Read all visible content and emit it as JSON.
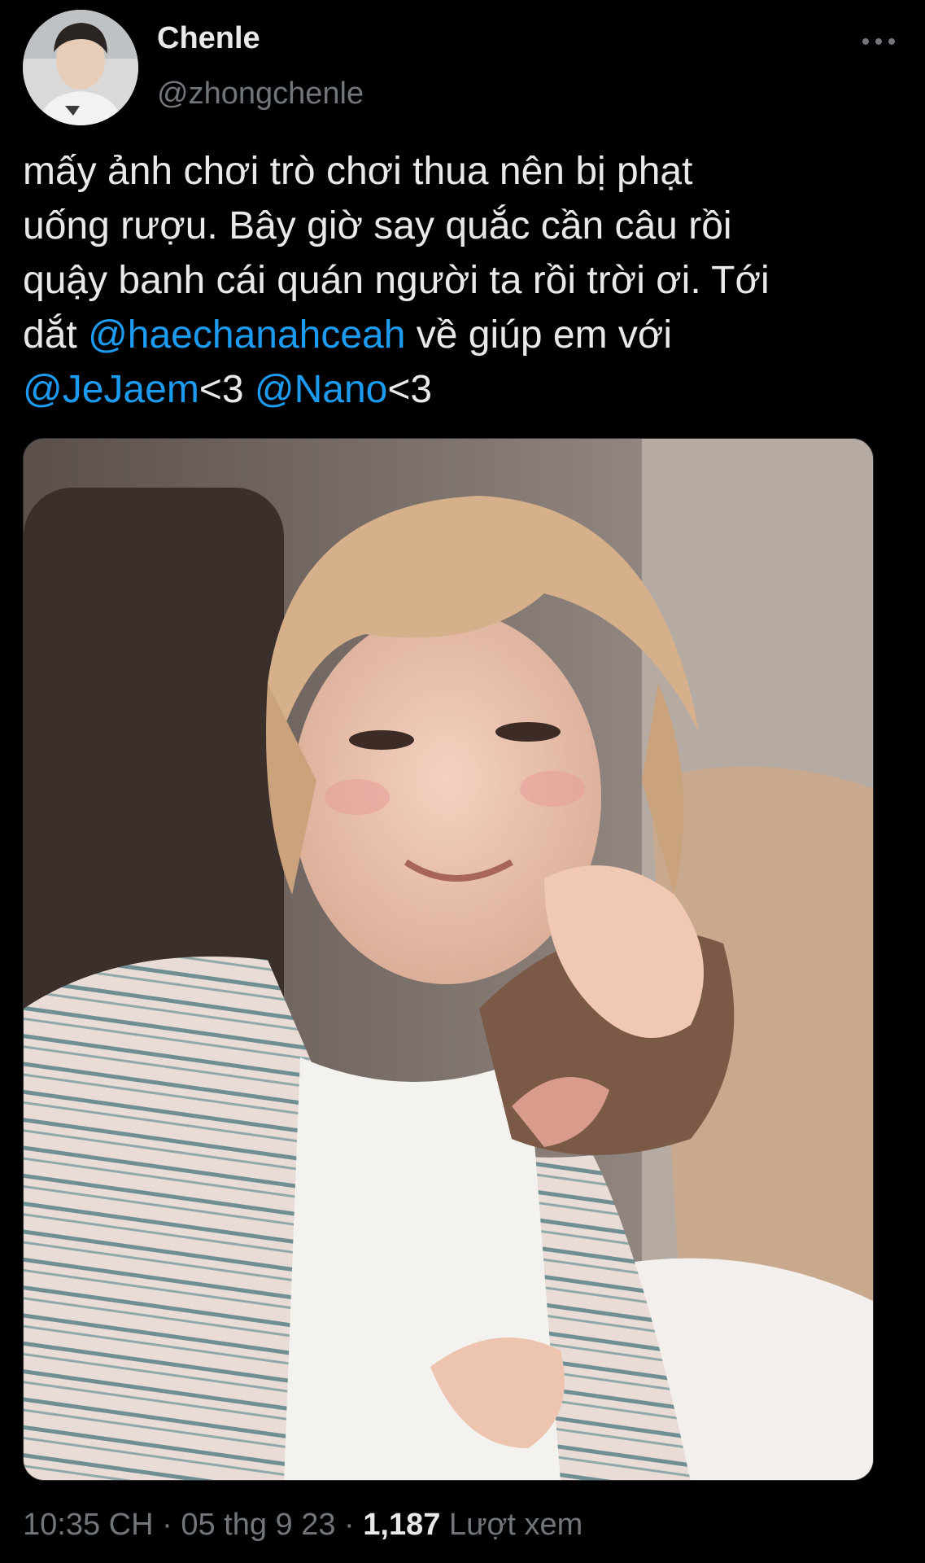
{
  "tweet": {
    "author": {
      "display_name": "Chenle",
      "handle": "@zhongchenle"
    },
    "text": {
      "line1": "mấy ảnh chơi trò chơi thua nên bị phạt",
      "line2": "uống rượu. Bây giờ say quắc cần câu rồi",
      "line3": "quậy banh cái quán người ta rồi trời ơi. Tới",
      "line4_prefix": "dắt ",
      "mention1": "@haechanahceah",
      "line4_suffix": " về giúp em với",
      "mention2": "@JeJaem",
      "heart1": "<3",
      "spacer": " ",
      "mention3": "@Nano",
      "heart2": "<3"
    },
    "meta": {
      "time": "10:35 CH",
      "sep1": " · ",
      "date": "05 thg 9 23",
      "sep2": " · ",
      "view_count": "1,187",
      "view_label": " Lượt xem"
    }
  },
  "colors": {
    "background": "#000000",
    "text": "#e7e9ea",
    "secondary": "#71767b",
    "mention": "#1d9bf0"
  },
  "icons": {
    "more": "more-horizontal-icon"
  }
}
